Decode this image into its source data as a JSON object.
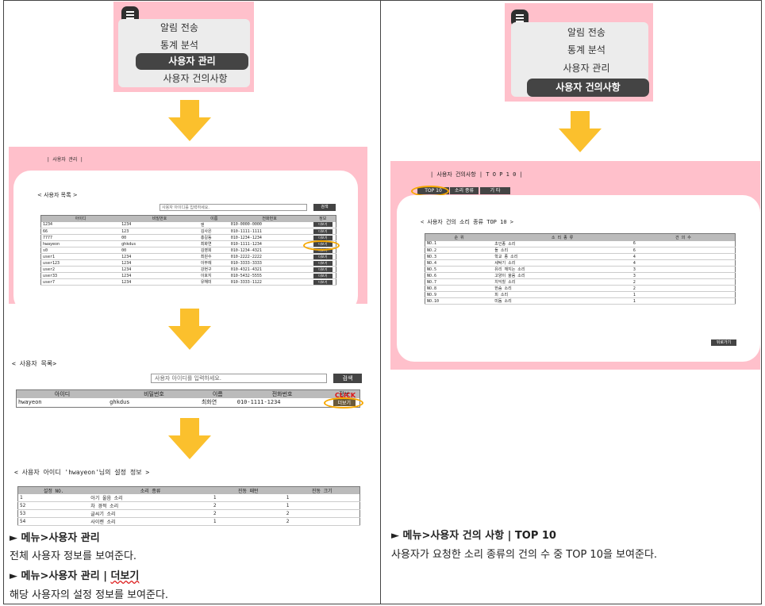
{
  "menu": {
    "items": [
      "알림 전송",
      "통계 분석",
      "사용자 관리",
      "사용자 건의사항"
    ]
  },
  "user_panel": {
    "breadcrumb": "| 사용자 관리 |",
    "title": "< 사용자 목록 >",
    "search_placeholder": "사용자 아이디를 입력하세요.",
    "search_button": "검색",
    "columns": [
      "아이디",
      "비밀번호",
      "이름",
      "전화번호",
      "정보"
    ],
    "rows": [
      [
        "1234",
        "1234",
        "엔",
        "010-0000-0000",
        "더보기"
      ],
      [
        "66",
        "123",
        "김사은",
        "010-1111-1111",
        "더보기"
      ],
      [
        "7777",
        "00",
        "홍길동",
        "010-1234-1234",
        "더보기"
      ],
      [
        "hwayeon",
        "ghkdus",
        "최화연",
        "010-1111-1234",
        "더보기"
      ],
      [
        "s0",
        "00",
        "김영희",
        "010-1234-4321",
        "더보기"
      ],
      [
        "user1",
        "1234",
        "최원수",
        "010-2222-2222",
        "더보기"
      ],
      [
        "user123",
        "1234",
        "이부례",
        "010-3333-3333",
        "더보기"
      ],
      [
        "user2",
        "1234",
        "강현구",
        "010-4321-4321",
        "더보기"
      ],
      [
        "user33",
        "1234",
        "이호지",
        "010-5432-5555",
        "더보기"
      ],
      [
        "user7",
        "1234",
        "유해미",
        "010-3333-1122",
        "더보기"
      ]
    ]
  },
  "zoom_panel": {
    "title": "< 사용자 목록>",
    "search_placeholder": "사용자 아이디를 입력하세요.",
    "search_button": "검색",
    "columns": [
      "아이디",
      "비밀번호",
      "이름",
      "전화번호",
      "정보"
    ],
    "row": [
      "hwayeon",
      "ghkdus",
      "최화연",
      "010-1111-1234",
      "더보기"
    ],
    "click_label": "CLICK"
  },
  "settings_panel": {
    "title": "< 사용자 아이디 'hwayeon'님의 설정 정보 >",
    "columns": [
      "설정 NO.",
      "소리 종류",
      "진동 패턴",
      "진동 크기"
    ],
    "rows": [
      [
        "1",
        "아기 울음 소리",
        "1",
        "1"
      ],
      [
        "52",
        "차 경적 소리",
        "2",
        "1"
      ],
      [
        "53",
        "글씨기 소리",
        "2",
        "2"
      ],
      [
        "54",
        "사이렌 소리",
        "1",
        "2"
      ]
    ]
  },
  "top10_panel": {
    "breadcrumb": "| 사용자 건의사항 | T O P 1 0 |",
    "tabs": [
      "TOP 10",
      "소리 종류",
      "기 타"
    ],
    "title": "< 사용자 건의 소리 종류 TOP 10 >",
    "columns": [
      "순 위",
      "소 리 종 류",
      "건 의 수"
    ],
    "rows": [
      [
        "NO.1",
        "초인종 소리",
        "6"
      ],
      [
        "NO.2",
        "돌 소리",
        "6"
      ],
      [
        "NO.3",
        "학교 종 소리",
        "4"
      ],
      [
        "NO.4",
        "세탁기 소리",
        "4"
      ],
      [
        "NO.5",
        "유리 깨지는 소리",
        "3"
      ],
      [
        "NO.6",
        "고양이 울음 소리",
        "3"
      ],
      [
        "NO.7",
        "치익힐 소리",
        "2"
      ],
      [
        "NO.8",
        "한숨 소리",
        "2"
      ],
      [
        "NO.9",
        "피 소리",
        "1"
      ],
      [
        "NO.10",
        "미돔 소리",
        "1"
      ]
    ],
    "back_button": "뒤로가기"
  },
  "captions": {
    "left1_title": "► 메뉴>사용자 관리",
    "left1_desc": "전체 사용자 정보를 보여준다.",
    "left2_title_a": "► 메뉴>사용자 관리 | ",
    "left2_title_b": "더보기",
    "left2_desc": "해당 사용자의 설정 정보를 보여준다.",
    "right_title": "► 메뉴>사용자 건의 사항 | TOP 10",
    "right_desc": "사용자가 요청한 소리 종류의 건의 수 중 TOP 10을 보여준다."
  }
}
